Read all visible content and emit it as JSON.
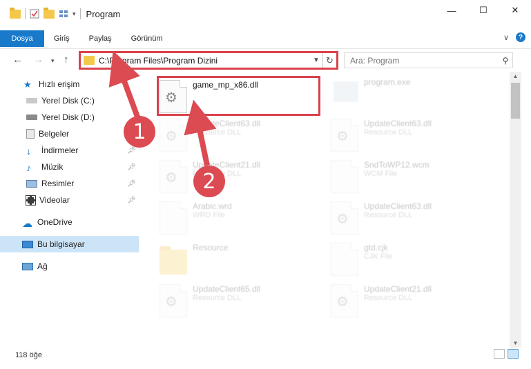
{
  "window": {
    "title": "Program",
    "minimize_glyph": "—",
    "maximize_glyph": "☐",
    "close_glyph": "✕"
  },
  "ribbon": {
    "tabs": [
      "Dosya",
      "Giriş",
      "Paylaş",
      "Görünüm"
    ],
    "expand_glyph": "∨",
    "help_glyph": "?"
  },
  "address": {
    "path": "C:\\Program Files\\Program Dizini",
    "search_placeholder": "Ara: Program"
  },
  "sidebar": {
    "items": [
      {
        "label": "Hızlı erişim",
        "icon": "star-icon"
      },
      {
        "label": "Yerel Disk (C:)",
        "icon": "drive-icon"
      },
      {
        "label": "Yerel Disk (D:)",
        "icon": "drive-icon"
      },
      {
        "label": "Belgeler",
        "icon": "documents-icon"
      },
      {
        "label": "İndirmeler",
        "icon": "download-icon"
      },
      {
        "label": "Müzik",
        "icon": "music-icon"
      },
      {
        "label": "Resimler",
        "icon": "pictures-icon"
      },
      {
        "label": "Videolar",
        "icon": "video-icon"
      },
      {
        "label": "OneDrive",
        "icon": "cloud-icon"
      },
      {
        "label": "Bu bilgisayar",
        "icon": "computer-icon"
      },
      {
        "label": "Ağ",
        "icon": "network-icon"
      }
    ]
  },
  "files": [
    {
      "name": "game_mp_x86.dll",
      "type": ""
    },
    {
      "name": "program.exe",
      "type": ""
    },
    {
      "name": "UpdateClient63.dll",
      "type": "Resource DLL"
    },
    {
      "name": "UpdateClient63.dll",
      "type": "Resource DLL"
    },
    {
      "name": "UpdateClient21.dll",
      "type": "Resource DLL"
    },
    {
      "name": "SndToWP12.wcm",
      "type": "WCM File"
    },
    {
      "name": "Arabic.wrd",
      "type": "WRD File"
    },
    {
      "name": "UpdateClient63.dll",
      "type": "Resource DLL"
    },
    {
      "name": "Resource",
      "type": ""
    },
    {
      "name": "gtd.cjk",
      "type": "CJK File"
    },
    {
      "name": "UpdateClient65.dll",
      "type": "Resource DLL"
    },
    {
      "name": "UpdateClient21.dll",
      "type": "Resource DLL"
    }
  ],
  "status": {
    "item_count": "118 öğe"
  },
  "annotations": {
    "step1": "1",
    "step2": "2"
  },
  "colors": {
    "accent": "#1979ca",
    "highlight": "#d9414c",
    "selected": "#cce4f7"
  }
}
